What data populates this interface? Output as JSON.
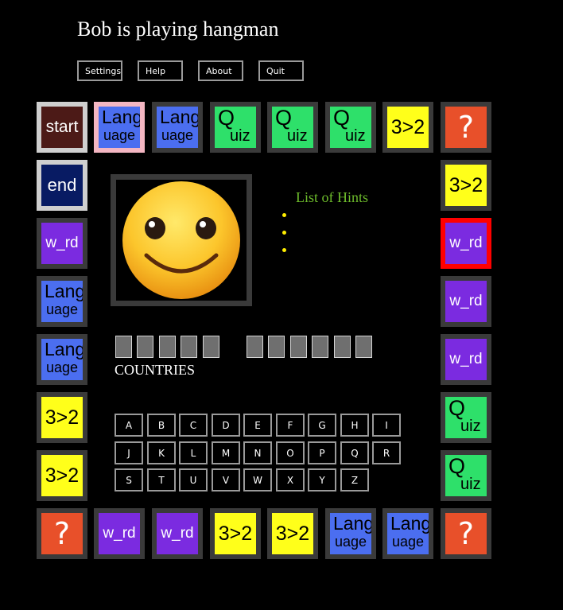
{
  "title": "Bob is playing hangman",
  "menu": [
    {
      "label": "Settings"
    },
    {
      "label": "Help"
    },
    {
      "label": "About"
    },
    {
      "label": "Quit"
    }
  ],
  "board": {
    "start_label": "start",
    "end_label": "end",
    "question_label": "?",
    "greater_label": "3>2",
    "word_label": "w_rd",
    "quiz_label": [
      "Q",
      "uiz"
    ],
    "language_label": [
      "Lang",
      "uage"
    ],
    "highlight_color": "#ff0000",
    "current_color": "#f4b6c2"
  },
  "hints": {
    "title": "List of Hints",
    "items": [
      "",
      "",
      ""
    ]
  },
  "word": {
    "category": "COUNTRIES",
    "slots_word1": [
      "",
      "",
      "",
      "",
      ""
    ],
    "slots_word2": [
      "",
      "",
      "",
      "",
      "",
      ""
    ]
  },
  "keyboard": {
    "rows": [
      [
        "A",
        "B",
        "C",
        "D",
        "E",
        "F",
        "G",
        "H",
        "I"
      ],
      [
        "J",
        "K",
        "L",
        "M",
        "N",
        "O",
        "P",
        "Q",
        "R"
      ],
      [
        "S",
        "T",
        "U",
        "V",
        "W",
        "X",
        "Y",
        "Z"
      ]
    ]
  },
  "colors": {
    "background": "#000000",
    "tile_border": "#3a3a3a",
    "hint_title": "#6dbb2b",
    "hint_bullet": "#ffee00"
  },
  "portrait_icon": "smiley-face-icon"
}
